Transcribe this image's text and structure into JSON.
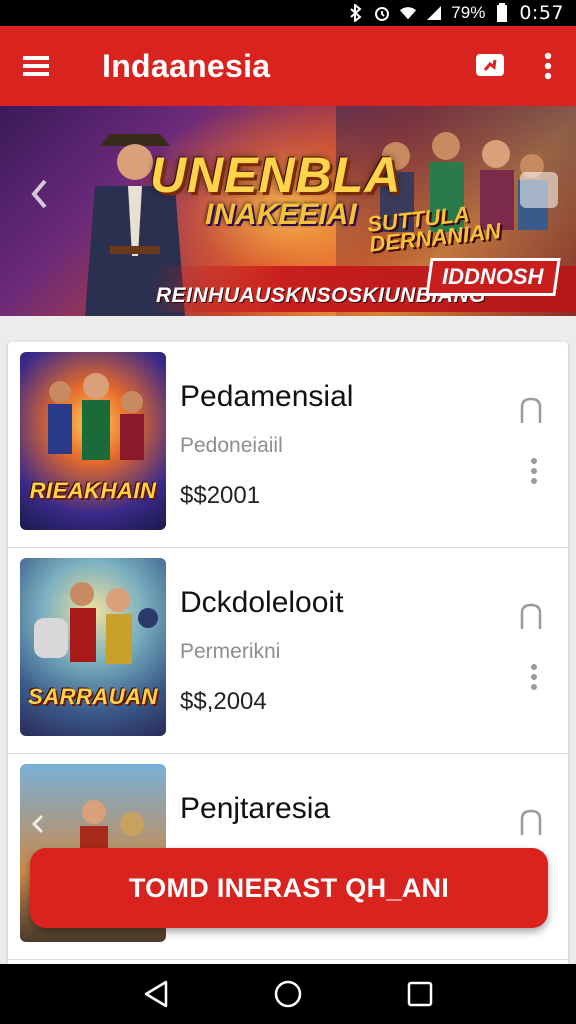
{
  "status_bar": {
    "battery_percent": "79%",
    "time": "0:57",
    "icons": [
      "bluetooth-icon",
      "alarm-icon",
      "wifi-icon",
      "signal-icon",
      "battery-icon"
    ]
  },
  "app_bar": {
    "title": "Indaanesia",
    "icons": [
      "hamburger-menu-icon",
      "chat-icon",
      "more-vertical-icon"
    ]
  },
  "banner": {
    "title_main": "UNENBLA",
    "title_secondary": "INAKEEIAI",
    "subtitle_right_1": "SUTTULA",
    "subtitle_right_2": "DERNANIAN",
    "tagline": "REINHUAUSKNSOSKIUNBIANG",
    "badge": "IDDNOSH"
  },
  "list": {
    "items": [
      {
        "title": "Pedamensial",
        "subtitle": "Pedoneiaiil",
        "price": "$$2001",
        "thumb_logo": "RIEAKHAIN"
      },
      {
        "title": "Dckdolelooit",
        "subtitle": "Permerikni",
        "price": "$$,2004",
        "thumb_logo": "SARRAUAN"
      },
      {
        "title": "Penjtaresia",
        "subtitle": "",
        "price": "",
        "thumb_logo": ""
      }
    ]
  },
  "cta": {
    "label": "TOMD INERAST QH_ANI"
  },
  "nav_bar": {
    "icons": [
      "back-icon",
      "home-icon",
      "recents-icon"
    ]
  },
  "colors": {
    "primary": "#d8231f",
    "background": "#ececec",
    "card": "#ffffff"
  }
}
